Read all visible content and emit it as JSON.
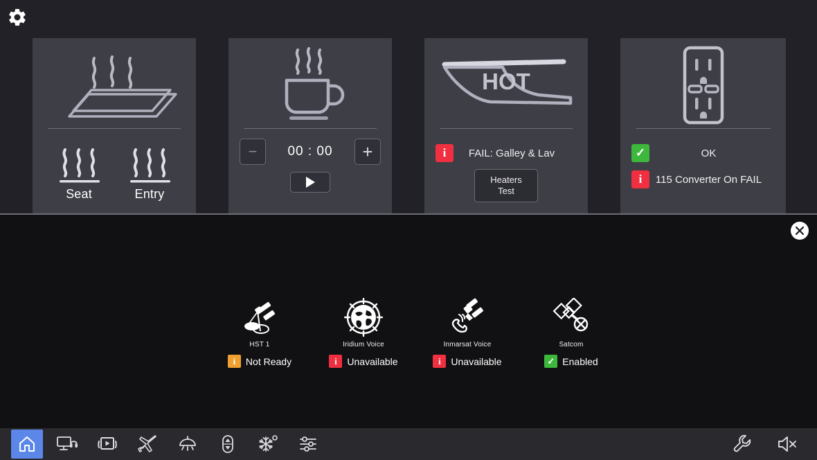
{
  "header": {
    "settings_icon": "gear-icon"
  },
  "cards": [
    {
      "id": "galley-heater",
      "icon": "heated-surface-icon",
      "controls": [
        {
          "icon": "heat-waves-icon",
          "label": "Seat"
        },
        {
          "icon": "heat-waves-icon",
          "label": "Entry"
        }
      ]
    },
    {
      "id": "coffee-maker",
      "icon": "coffee-cup-icon",
      "timer": {
        "value": "00 : 00",
        "decrement_label": "−",
        "increment_label": "+",
        "play_label": "play-icon"
      }
    },
    {
      "id": "hot-surface-heaters",
      "icon": "hot-wing-icon",
      "icon_text": "HOT",
      "status": {
        "level": "fail",
        "badge": "i",
        "text": "FAIL: Galley & Lav"
      },
      "button": {
        "line1": "Heaters",
        "line2": "Test"
      }
    },
    {
      "id": "power-outlet",
      "icon": "power-outlet-icon",
      "statuses": [
        {
          "level": "ok",
          "badge": "✓",
          "text": "OK"
        },
        {
          "level": "fail",
          "badge": "i",
          "text": "115 Converter On FAIL"
        }
      ]
    }
  ],
  "lower_panel": {
    "close_label": "✕",
    "satcom": [
      {
        "icon": "satellite-dish-icon",
        "name": "HST 1",
        "level": "warn",
        "badge": "i",
        "status": "Not Ready"
      },
      {
        "icon": "globe-icon",
        "name": "Iridium Voice",
        "level": "fail",
        "badge": "i",
        "status": "Unavailable"
      },
      {
        "icon": "satellite-phone-icon",
        "name": "Inmarsat Voice",
        "level": "fail",
        "badge": "i",
        "status": "Unavailable"
      },
      {
        "icon": "satellite-off-icon",
        "name": "Satcom",
        "level": "ok",
        "badge": "✓",
        "status": "Enabled"
      }
    ]
  },
  "taskbar": {
    "left_items": [
      {
        "icon": "home-icon",
        "name": "home",
        "active": true
      },
      {
        "icon": "cabin-crew-icon",
        "name": "crew-call",
        "active": false
      },
      {
        "icon": "media-icon",
        "name": "media",
        "active": false
      },
      {
        "icon": "flight-icon",
        "name": "flight-info",
        "active": false
      },
      {
        "icon": "lighting-icon",
        "name": "lighting",
        "active": false
      },
      {
        "icon": "seat-move-icon",
        "name": "seat-position",
        "active": false
      },
      {
        "icon": "climate-icon",
        "name": "climate",
        "active": false
      },
      {
        "icon": "settings-sliders-icon",
        "name": "adjustments",
        "active": false
      }
    ],
    "right_items": [
      {
        "icon": "wrench-icon",
        "name": "maintenance",
        "active": false
      },
      {
        "icon": "speaker-mute-icon",
        "name": "mute",
        "active": false
      }
    ]
  },
  "colors": {
    "accent": "#5b87e8",
    "fail": "#f03040",
    "warn": "#f0a030",
    "ok": "#3db83d",
    "card_bg": "#3e3e46",
    "panel_bg": "#212127",
    "lower_bg": "#111113"
  }
}
